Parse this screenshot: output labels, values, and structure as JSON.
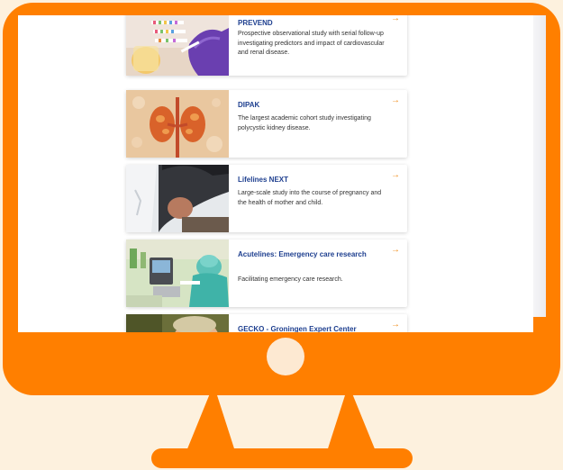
{
  "studies": [
    {
      "title": "PREVEND",
      "description": "Prospective observational study with serial follow-up investigating predictors and impact of cardiovascular and renal disease."
    },
    {
      "title": "DIPAK",
      "description": "The largest academic cohort study investigating polycystic kidney disease."
    },
    {
      "title": "Lifelines NEXT",
      "description": "Large-scale study into the course of pregnancy and the health of mother and child."
    },
    {
      "title": "Acutelines: Emergency care research",
      "description": "Facilitating emergency care research."
    },
    {
      "title": "GECKO - Groningen Expert Center",
      "description": ""
    }
  ],
  "arrow_glyph": "→",
  "colors": {
    "monitor": "#ff7f00",
    "background": "#fdf1de",
    "title": "#1e3f8f",
    "arrow": "#f08c1a"
  }
}
